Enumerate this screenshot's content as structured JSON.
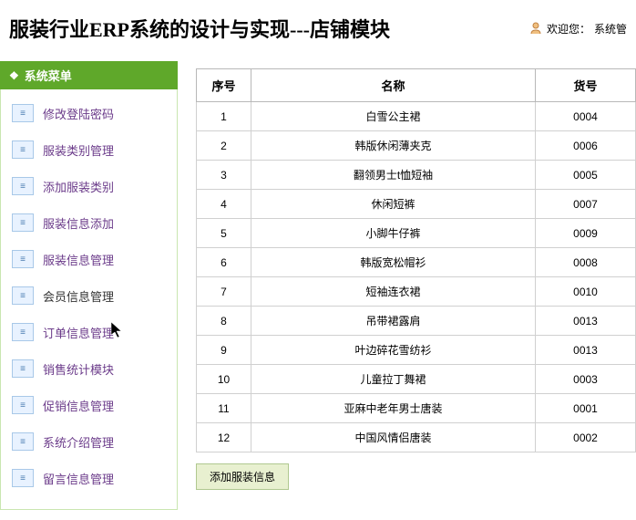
{
  "header": {
    "title": "服装行业ERP系统的设计与实现---店铺模块",
    "welcome_label": "欢迎您：",
    "welcome_user": "系统管"
  },
  "sidebar": {
    "title": "系统菜单",
    "items": [
      {
        "label": "修改登陆密码"
      },
      {
        "label": "服装类别管理"
      },
      {
        "label": "添加服装类别"
      },
      {
        "label": "服装信息添加"
      },
      {
        "label": "服装信息管理"
      },
      {
        "label": "会员信息管理"
      },
      {
        "label": "订单信息管理"
      },
      {
        "label": "销售统计模块"
      },
      {
        "label": "促销信息管理"
      },
      {
        "label": "系统介绍管理"
      },
      {
        "label": "留言信息管理"
      }
    ]
  },
  "table": {
    "headers": {
      "index": "序号",
      "name": "名称",
      "code": "货号"
    },
    "rows": [
      {
        "index": "1",
        "name": "白雪公主裙",
        "code": "0004"
      },
      {
        "index": "2",
        "name": "韩版休闲薄夹克",
        "code": "0006"
      },
      {
        "index": "3",
        "name": "翻领男士t恤短袖",
        "code": "0005"
      },
      {
        "index": "4",
        "name": "休闲短裤",
        "code": "0007"
      },
      {
        "index": "5",
        "name": "小脚牛仔裤",
        "code": "0009"
      },
      {
        "index": "6",
        "name": "韩版宽松帽衫",
        "code": "0008"
      },
      {
        "index": "7",
        "name": "短袖连衣裙",
        "code": "0010"
      },
      {
        "index": "8",
        "name": "吊带裙露肩",
        "code": "0013"
      },
      {
        "index": "9",
        "name": "叶边碎花雪纺衫",
        "code": "0013"
      },
      {
        "index": "10",
        "name": "儿童拉丁舞裙",
        "code": "0003"
      },
      {
        "index": "11",
        "name": "亚麻中老年男士唐装",
        "code": "0001"
      },
      {
        "index": "12",
        "name": "中国风情侣唐装",
        "code": "0002"
      }
    ]
  },
  "buttons": {
    "add_clothing": "添加服装信息"
  }
}
